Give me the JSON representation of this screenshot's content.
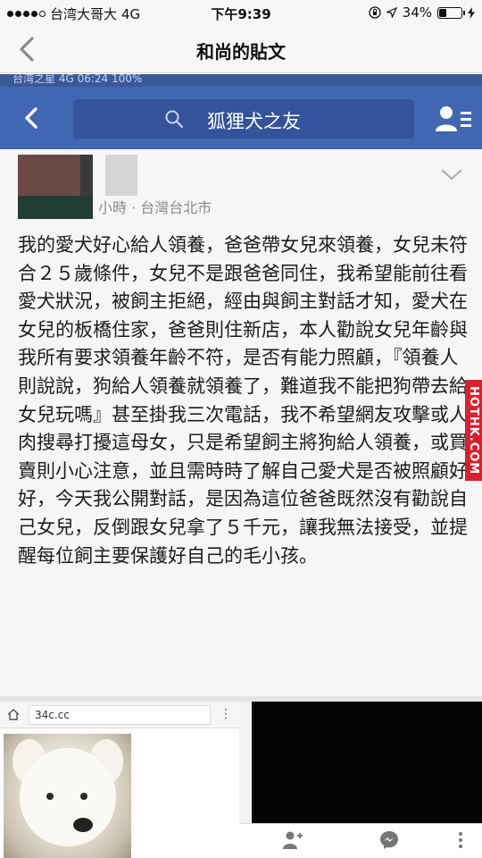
{
  "status_bar": {
    "carrier": "台湾大哥大",
    "network": "4G",
    "time": "下午9:39",
    "battery": "34%",
    "battery_level": 0.34,
    "signal_bars": 4
  },
  "nav": {
    "title": "和尚的貼文"
  },
  "embedded_screenshot": {
    "top_status": "台湾之星  4G  06:24          100%",
    "search_text": "狐狸犬之友",
    "post": {
      "meta": "小時 · 台灣台北市",
      "body": "我的愛犬好心給人領養，爸爸帶女兒來領養，女兒未符合２５歲條件，女兒不是跟爸爸同住，我希望能前往看愛犬狀況，被飼主拒絕，經由與飼主對話才知，愛犬在女兒的板橋住家，爸爸則住新店，本人勸說女兒年齡與我所有要求領養年齡不符，是否有能力照顧，『領養人則說說，狗給人領養就領養了，難道我不能把狗帶去給女兒玩嗎』甚至掛我三次電話，我不希望網友攻擊或人肉搜尋打擾這母女，只是希望飼主將狗給人領養，或買賣則小心注意，並且需時時了解自己愛犬是否被照顧好好，今天我公開對話，是因為這位爸爸既然沒有勸說自己女兒，反倒跟女兒拿了５千元，讓我無法接受，並提醒每位飼主要保護好自己的毛小孩。"
    },
    "browser": {
      "url": "34c.cc",
      "menu_glyph": "⋮"
    },
    "watermark": "HOTHK.COM"
  },
  "colors": {
    "fb_blue": "#4267b2",
    "fb_blue_dark": "#34539a",
    "watermark_red": "#d8202f"
  }
}
